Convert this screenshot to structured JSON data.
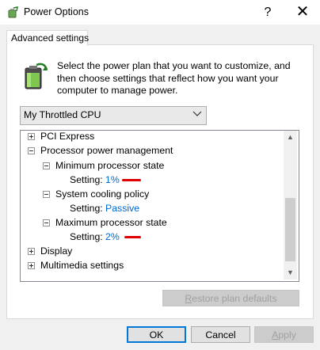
{
  "window": {
    "title": "Power Options",
    "help_glyph": "?",
    "close_glyph": "✕"
  },
  "tab": {
    "label": "Advanced settings"
  },
  "intro": {
    "text": "Select the power plan that you want to customize, and then choose settings that reflect how you want your computer to manage power."
  },
  "plan": {
    "selected": "My Throttled CPU"
  },
  "tree": {
    "pci_express": "PCI Express",
    "processor_power_management": "Processor power management",
    "min_state": {
      "label": "Minimum processor state",
      "setting_label": "Setting:",
      "value": "1%"
    },
    "cooling": {
      "label": "System cooling policy",
      "setting_label": "Setting:",
      "value": "Passive"
    },
    "max_state": {
      "label": "Maximum processor state",
      "setting_label": "Setting:",
      "value": "2%"
    },
    "display": "Display",
    "multimedia": "Multimedia settings"
  },
  "buttons": {
    "restore_prefix": "R",
    "restore_rest": "estore plan defaults",
    "ok": "OK",
    "cancel": "Cancel",
    "apply_prefix": "A",
    "apply_rest": "pply"
  },
  "colors": {
    "link": "#0066cc",
    "annotation_red": "#e00000"
  }
}
